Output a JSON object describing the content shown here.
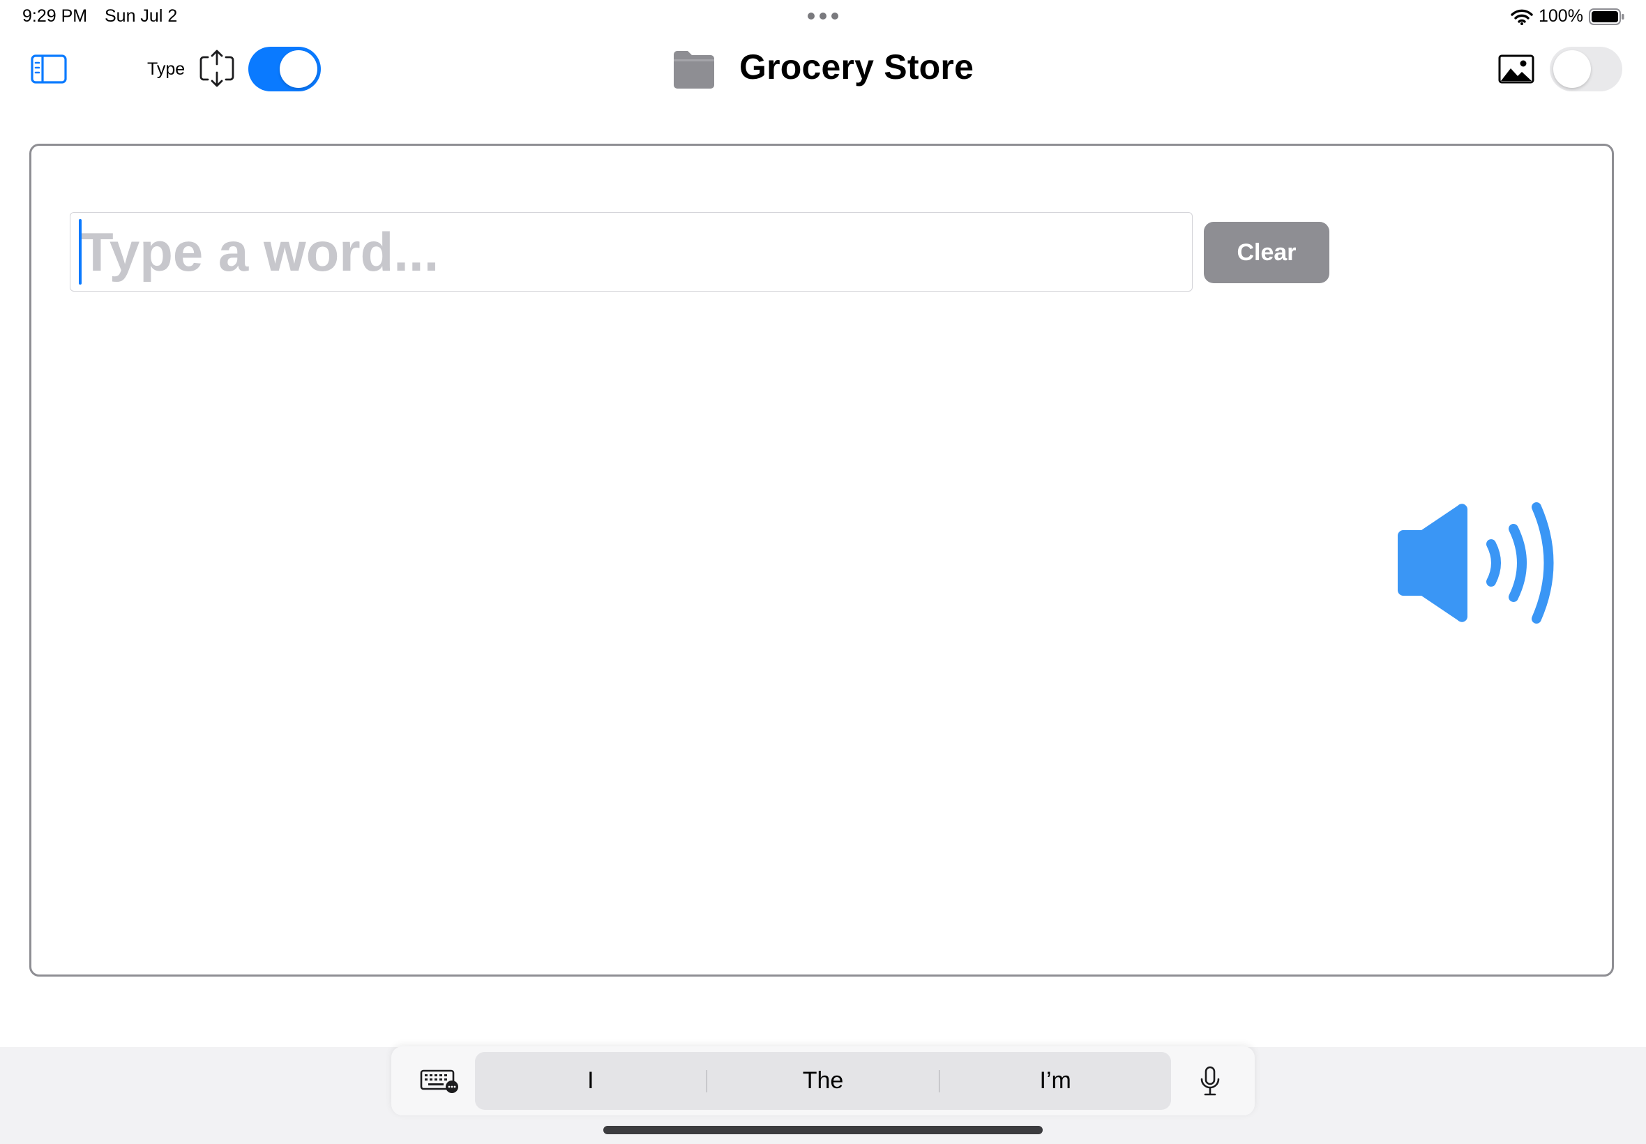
{
  "status_bar": {
    "time": "9:29 PM",
    "date": "Sun Jul 2",
    "battery_percent": "100%",
    "battery_level": 1.0
  },
  "toolbar": {
    "type_label": "Type",
    "type_toggle_on": true,
    "folder_title": "Grocery Store",
    "image_toggle_on": false
  },
  "main": {
    "word_input": {
      "value": "",
      "placeholder": "Type a word..."
    },
    "clear_label": "Clear"
  },
  "keyboard_bar": {
    "suggestions": [
      "I",
      "The",
      "I’m"
    ]
  },
  "colors": {
    "accent": "#0a7aff",
    "speaker": "#3a96f5",
    "clear_button": "#8e8e93",
    "panel_border": "#8e8e93"
  },
  "icons": {
    "sidebar": "sidebar-left-icon",
    "resize": "arrow-up-down-frame-icon",
    "folder": "folder-icon",
    "image": "photo-icon",
    "speaker": "speaker-wave-3-icon",
    "keyboard": "keyboard-icon",
    "mic": "mic-icon",
    "wifi": "wifi-icon",
    "battery": "battery-icon"
  }
}
